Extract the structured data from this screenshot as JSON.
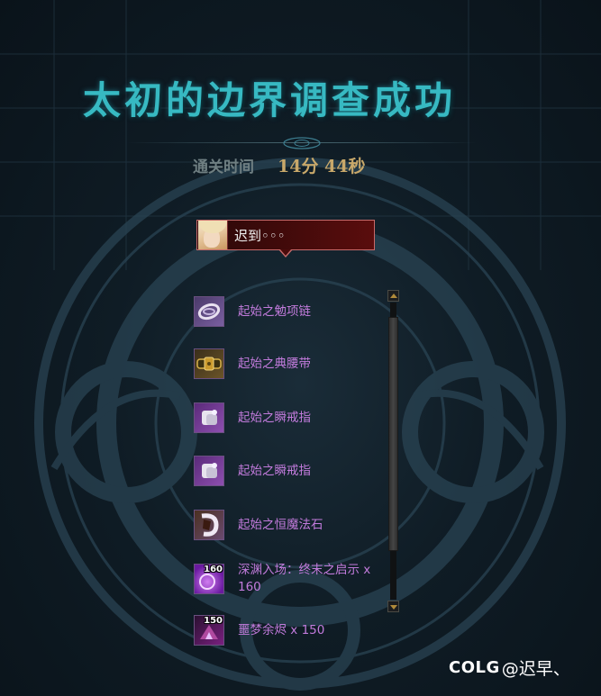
{
  "header": {
    "title": "太初的边界调查成功",
    "clear_time_label": "通关时间",
    "clear_time_value": "14分 44秒"
  },
  "player": {
    "name": "迟到◦◦◦"
  },
  "loot": [
    {
      "name": "起始之勉项链",
      "icon": "necklace-icon"
    },
    {
      "name": "起始之典腰带",
      "icon": "belt-icon"
    },
    {
      "name": "起始之瞬戒指",
      "icon": "ring-icon"
    },
    {
      "name": "起始之瞬戒指",
      "icon": "ring-icon"
    },
    {
      "name": "起始之恒魔法石",
      "icon": "magic-stone-icon"
    },
    {
      "name": "深渊入场：终末之启示 x 160",
      "icon": "abyss-ticket-icon",
      "count": "160"
    },
    {
      "name": "噩梦余烬 x 150",
      "icon": "nightmare-ember-icon",
      "count": "150"
    }
  ],
  "watermark": {
    "logo": "COLG",
    "user": "@迟早、"
  },
  "colors": {
    "title": "#37b9c2",
    "item_epic": "#c27bdc",
    "time": "#c8a86a",
    "player_box": "#5a0d0d"
  }
}
